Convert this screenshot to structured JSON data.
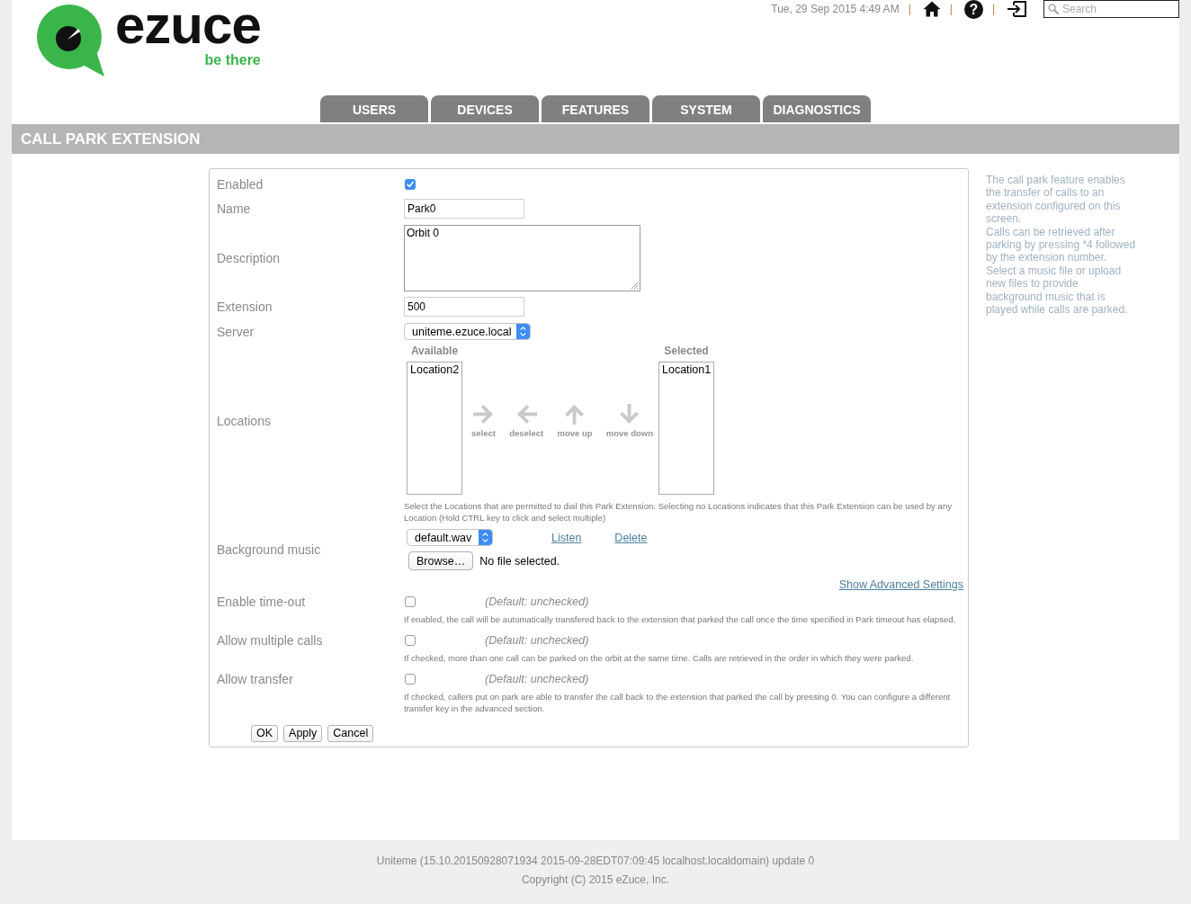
{
  "header": {
    "logo": {
      "wordmark": "ezuce",
      "tagline": "be there"
    },
    "utility": [
      {
        "kind": "date",
        "text": "Tue, 29 Sep 2015 4:49 AM"
      },
      {
        "kind": "separator",
        "text": "|"
      },
      {
        "kind": "home"
      },
      {
        "kind": "separator",
        "text": "|"
      },
      {
        "kind": "help",
        "text": "?"
      },
      {
        "kind": "separator",
        "text": "|"
      },
      {
        "kind": "logout"
      }
    ],
    "search": {
      "placeholder": "Search"
    }
  },
  "tabs": [
    {
      "label": "USERS",
      "selected": false
    },
    {
      "label": "DEVICES",
      "selected": false
    },
    {
      "label": "FEATURES",
      "selected": false
    },
    {
      "label": "SYSTEM",
      "selected": false
    },
    {
      "label": "DIAGNOSTICS",
      "selected": false
    }
  ],
  "page_title": "CALL PARK EXTENSION",
  "form": {
    "rows": [
      {
        "kind": "checkbox",
        "label": "Enabled",
        "checked": true
      },
      {
        "kind": "text",
        "label": "Name",
        "value": "Park0"
      },
      {
        "kind": "textarea",
        "label": "Description",
        "value": "Orbit 0"
      },
      {
        "kind": "text",
        "label": "Extension",
        "value": "500"
      },
      {
        "kind": "select",
        "label": "Server",
        "value": "uniteme.ezuce.local"
      },
      {
        "kind": "locations",
        "label": "Locations",
        "lists": [
          {
            "heading": "Available",
            "items": [
              {
                "label": "Location2",
                "selected": false
              }
            ]
          },
          {
            "heading": "Selected",
            "items": [
              {
                "label": "Location1",
                "selected": false
              }
            ]
          }
        ],
        "actions": [
          {
            "kind": "right",
            "label": "select",
            "disabled": true
          },
          {
            "kind": "left",
            "label": "deselect",
            "disabled": true
          },
          {
            "kind": "up",
            "label": "move up",
            "disabled": true
          },
          {
            "kind": "down",
            "label": "move down",
            "disabled": true
          }
        ],
        "help": "Select the Locations that are permitted to dial this Park Extension. Selecting no Locations indicates that this Park Extension can be used by any Location (Hold CTRL key to click and select multiple)"
      },
      {
        "kind": "music",
        "label": "Background music",
        "value": "default.wav",
        "links": [
          "Listen",
          "Delete"
        ],
        "browse": "Browse…",
        "file_status": "No file selected."
      },
      {
        "kind": "link",
        "label": "Show Advanced Settings"
      },
      {
        "kind": "option",
        "label": "Enable time-out",
        "checked": false,
        "default": "(Default: unchecked)",
        "help": "If enabled, the call will be automatically transfered back to the extension that parked the call once the time specified in Park timeout has elapsed."
      },
      {
        "kind": "option",
        "label": "Allow multiple calls",
        "checked": false,
        "default": "(Default: unchecked)",
        "help": "If checked, more than one call can be parked on the orbit at the same time. Calls are retrieved in the order in which they were parked."
      },
      {
        "kind": "option",
        "label": "Allow transfer",
        "checked": false,
        "default": "(Default: unchecked)",
        "help": "If checked, callers put on park are able to transfer the call back to the extension that parked the call by pressing 0. You can configure a different transfer key in the advanced section."
      }
    ],
    "buttons": [
      "OK",
      "Apply",
      "Cancel"
    ]
  },
  "help_panel": [
    "The call park feature enables the transfer of calls to an extension configured on this screen.",
    "Calls can be retrieved after parking by pressing *4 followed by the extension number.",
    "Select a music file or upload new files to provide background music that is played while calls are parked."
  ],
  "footer": [
    "Uniteme (15.10.20150928071934 2015-09-28EDT07:09:45 localhost.localdomain) update 0",
    "Copyright (C) 2015 eZuce, Inc."
  ]
}
